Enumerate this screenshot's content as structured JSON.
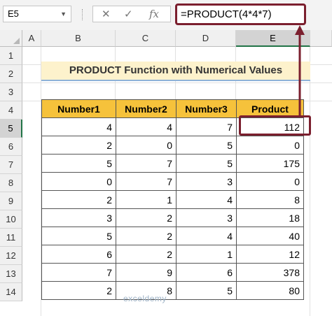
{
  "formula_bar": {
    "name_box": "E5",
    "fx_label": "fx",
    "cancel_icon": "✕",
    "confirm_icon": "✓",
    "formula": "=PRODUCT(4*4*7)"
  },
  "columns": [
    "A",
    "B",
    "C",
    "D",
    "E"
  ],
  "selected_column": "E",
  "rows": [
    "1",
    "2",
    "3",
    "4",
    "5",
    "6",
    "7",
    "8",
    "9",
    "10",
    "11",
    "12",
    "13",
    "14"
  ],
  "selected_row": "5",
  "sheet": {
    "title": "PRODUCT Function with Numerical Values",
    "headers": [
      "Number1",
      "Number2",
      "Number3",
      "Product"
    ],
    "data": [
      [
        "4",
        "4",
        "7",
        "112"
      ],
      [
        "2",
        "0",
        "5",
        "0"
      ],
      [
        "5",
        "7",
        "5",
        "175"
      ],
      [
        "0",
        "7",
        "3",
        "0"
      ],
      [
        "2",
        "1",
        "4",
        "8"
      ],
      [
        "3",
        "2",
        "3",
        "18"
      ],
      [
        "5",
        "2",
        "4",
        "40"
      ],
      [
        "6",
        "2",
        "1",
        "12"
      ],
      [
        "7",
        "9",
        "6",
        "378"
      ],
      [
        "2",
        "8",
        "5",
        "80"
      ]
    ]
  },
  "watermark": "exceldemy",
  "colors": {
    "highlight": "#7b1f2e",
    "header_fill": "#f6c23b",
    "title_fill": "#fdf2cc",
    "selection": "#217346"
  }
}
